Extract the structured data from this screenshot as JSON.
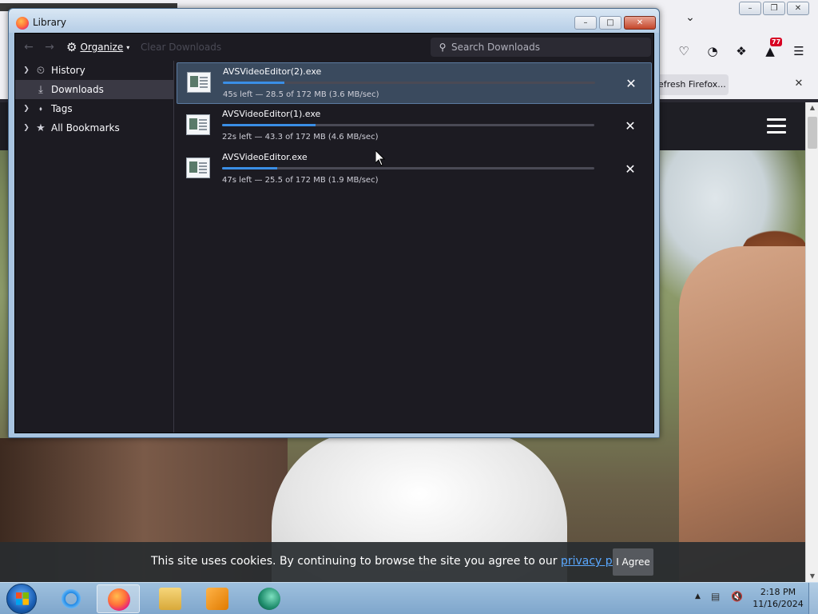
{
  "browser": {
    "notification_button": "efresh Firefox...",
    "toolbar_badge": "77"
  },
  "cookie_bar": {
    "text": "This site uses cookies. By continuing to browse the site you agree to our ",
    "link": "privacy policy",
    "after_link": ".",
    "agree_label": "I Agree"
  },
  "library": {
    "title": "Library",
    "toolbar": {
      "organize_label": "Organize",
      "clear_label": "Clear Downloads",
      "search_placeholder": "Search Downloads"
    },
    "sidebar": [
      {
        "label": "History",
        "icon": "clock-icon",
        "selected": false
      },
      {
        "label": "Downloads",
        "icon": "download-icon",
        "selected": true
      },
      {
        "label": "Tags",
        "icon": "tag-icon",
        "selected": false
      },
      {
        "label": "All Bookmarks",
        "icon": "star-icon",
        "selected": false
      }
    ],
    "downloads": [
      {
        "name": "AVSVideoEditor(2).exe",
        "progress": 0.166,
        "status": "45s left — 28.5 of 172 MB (3.6 MB/sec)",
        "selected": true
      },
      {
        "name": "AVSVideoEditor(1).exe",
        "progress": 0.252,
        "status": "22s left — 43.3 of 172 MB (4.6 MB/sec)",
        "selected": false
      },
      {
        "name": "AVSVideoEditor.exe",
        "progress": 0.148,
        "status": "47s left — 25.5 of 172 MB (1.9 MB/sec)",
        "selected": false
      }
    ]
  },
  "taskbar": {
    "time": "2:18 PM",
    "date": "11/16/2024"
  },
  "colors": {
    "progress": "#3a8ee6",
    "library_bg": "#1c1b22",
    "selected_row": "#3a4a5e"
  }
}
